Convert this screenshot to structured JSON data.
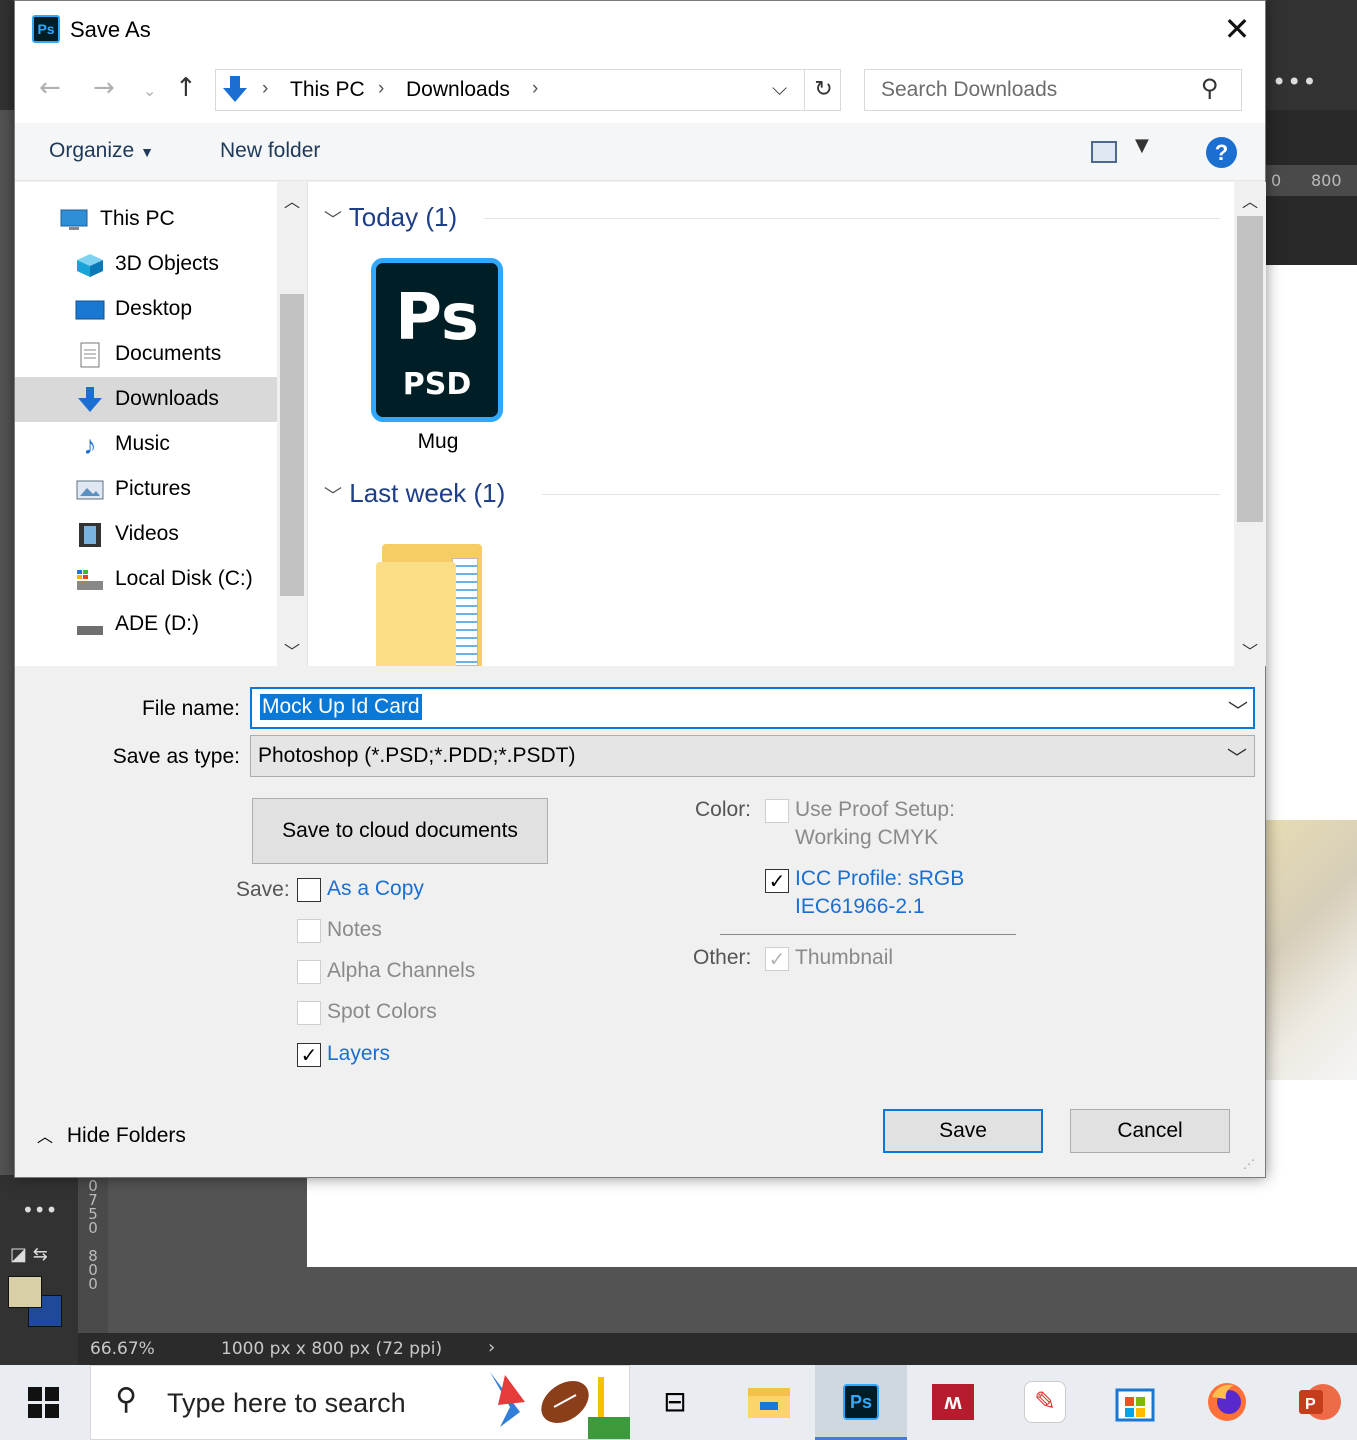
{
  "dialog": {
    "title": "Save As",
    "close_icon": "close-icon"
  },
  "navigation": {
    "path": [
      "This PC",
      "Downloads"
    ],
    "search_placeholder": "Search Downloads"
  },
  "commands": {
    "organize": "Organize",
    "new_folder": "New folder"
  },
  "nav_pane": {
    "items": [
      {
        "label": "This PC",
        "icon": "computer-icon"
      },
      {
        "label": "3D Objects",
        "icon": "cube-icon"
      },
      {
        "label": "Desktop",
        "icon": "desktop-icon"
      },
      {
        "label": "Documents",
        "icon": "document-icon"
      },
      {
        "label": "Downloads",
        "icon": "download-icon",
        "selected": true
      },
      {
        "label": "Music",
        "icon": "music-icon"
      },
      {
        "label": "Pictures",
        "icon": "pictures-icon"
      },
      {
        "label": "Videos",
        "icon": "film-icon"
      },
      {
        "label": "Local Disk (C:)",
        "icon": "disk-icon"
      },
      {
        "label": "ADE (D:)",
        "icon": "drive-icon"
      }
    ]
  },
  "files": {
    "groups": [
      {
        "header": "Today (1)",
        "items": [
          {
            "name": "Mug",
            "icon_main": "Ps",
            "icon_ext": "PSD"
          }
        ]
      },
      {
        "header": "Last week (1)",
        "items": [
          {
            "name": "",
            "icon": "folder-icon"
          }
        ]
      }
    ]
  },
  "form": {
    "file_name_label": "File name:",
    "file_name_value": "Mock Up Id Card",
    "save_type_label": "Save as type:",
    "save_type_value": "Photoshop (*.PSD;*.PDD;*.PSDT)",
    "cloud_button": "Save to cloud documents",
    "save_label": "Save:",
    "save_options": [
      {
        "label": "As a Copy",
        "checked": false,
        "enabled": true
      },
      {
        "label": "Notes",
        "checked": false,
        "enabled": false
      },
      {
        "label": "Alpha Channels",
        "checked": false,
        "enabled": false
      },
      {
        "label": "Spot Colors",
        "checked": false,
        "enabled": false
      },
      {
        "label": "Layers",
        "checked": true,
        "enabled": true
      }
    ],
    "color_label": "Color:",
    "proof_line1": "Use Proof Setup:",
    "proof_line2": "Working CMYK",
    "icc_line1": "ICC Profile:  sRGB",
    "icc_line2": "IEC61966-2.1",
    "other_label": "Other:",
    "thumbnail": "Thumbnail",
    "hide_folders": "Hide Folders",
    "save_button": "Save",
    "cancel_button": "Cancel"
  },
  "photoshop": {
    "zoom": "66.67%",
    "doc_info": "1000 px x 800 px (72 ppi)",
    "ruler_top": [
      "0",
      "800"
    ],
    "ruler_left": "0\n7\n5\n0\n\n8\n0\n0"
  },
  "taskbar": {
    "search_placeholder": "Type here to search",
    "apps": [
      "task-view-icon",
      "file-explorer-icon",
      "photoshop-icon",
      "mendeley-icon",
      "pen-app-icon",
      "store-icon",
      "firefox-icon",
      "powerpoint-icon"
    ]
  },
  "colors": {
    "accent": "#0a78d7",
    "ps_blue": "#31a8ff",
    "group_header": "#1e3e86"
  }
}
